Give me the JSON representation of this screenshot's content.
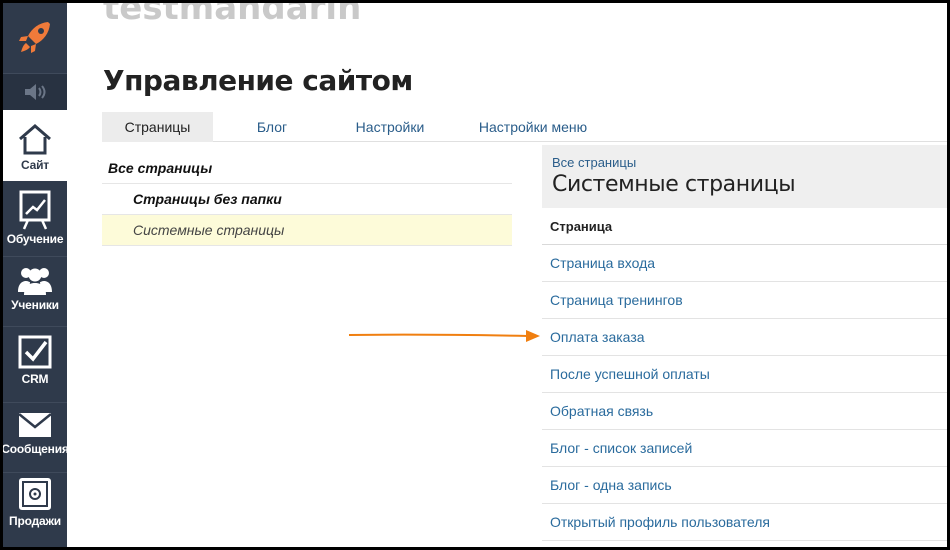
{
  "site_name": "testmandarin",
  "page_title": "Управление сайтом",
  "sidebar": {
    "items": [
      {
        "label": "Сайт",
        "icon": "home-icon"
      },
      {
        "label": "Обучение",
        "icon": "chart-board-icon"
      },
      {
        "label": "Ученики",
        "icon": "users-icon"
      },
      {
        "label": "CRM",
        "icon": "checkbox-icon"
      },
      {
        "label": "Сообщения",
        "icon": "mail-icon"
      },
      {
        "label": "Продажи",
        "icon": "safe-icon"
      }
    ]
  },
  "tabs": [
    {
      "label": "Страницы"
    },
    {
      "label": "Блог"
    },
    {
      "label": "Настройки"
    },
    {
      "label": "Настройки меню"
    }
  ],
  "folders": [
    {
      "label": "Все страницы"
    },
    {
      "label": "Страницы без папки"
    },
    {
      "label": "Системные страницы"
    }
  ],
  "panel": {
    "breadcrumb": "Все страницы",
    "title": "Системные страницы",
    "column_header": "Страница",
    "rows": [
      "Страница входа",
      "Страница тренингов",
      "Оплата заказа",
      "После успешной оплаты",
      "Обратная связь",
      "Блог - список записей",
      "Блог - одна запись",
      "Открытый профиль пользователя"
    ]
  },
  "colors": {
    "sidebar_bg": "#2f3a4b",
    "link": "#2a6b9d",
    "arrow": "#f07f10",
    "rocket": "#f07a3a"
  }
}
